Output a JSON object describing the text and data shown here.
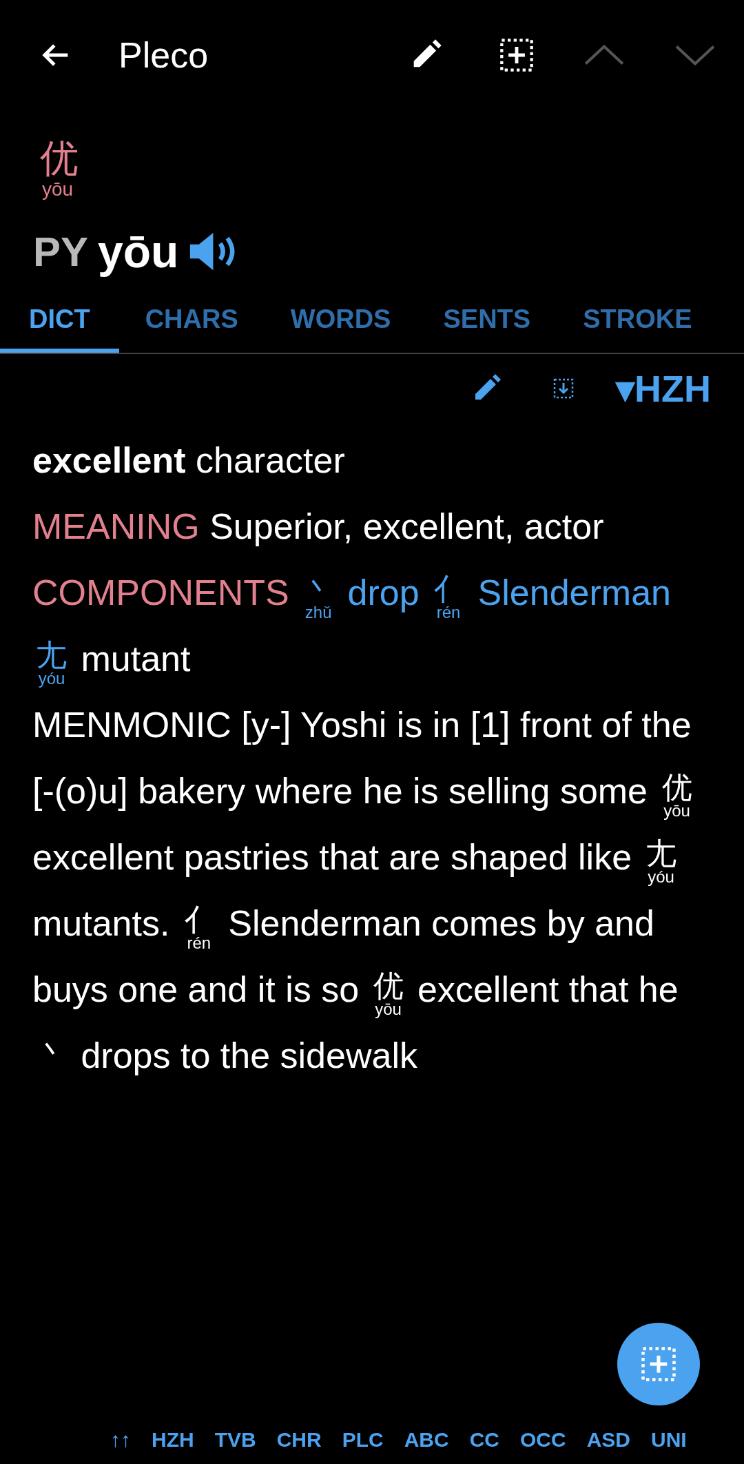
{
  "app_bar": {
    "title": "Pleco",
    "up_disabled": true,
    "down_disabled": true
  },
  "headword": {
    "character": "优",
    "pinyin": "yōu"
  },
  "reading": {
    "label": "PY",
    "pinyin": "yōu"
  },
  "tabs": [
    {
      "label": "DICT",
      "selected": true
    },
    {
      "label": "CHARS",
      "selected": false
    },
    {
      "label": "WORDS",
      "selected": false
    },
    {
      "label": "SENTS",
      "selected": false
    },
    {
      "label": "STROKE",
      "selected": false
    }
  ],
  "entry_toolbar": {
    "dictionary": "▾HZH"
  },
  "definition": [
    [
      {
        "kind": "bold",
        "text": "excellent"
      },
      {
        "kind": "text",
        "text": "character"
      }
    ],
    [
      {
        "kind": "label",
        "text": "MEANING"
      },
      {
        "kind": "text",
        "text": "Superior, excellent, actor"
      }
    ],
    [
      {
        "kind": "label",
        "text": "COMPONENTS"
      },
      {
        "kind": "ruby_link",
        "char": "丶",
        "pinyin": "zhǔ"
      },
      {
        "kind": "link",
        "text": "drop"
      },
      {
        "kind": "ruby_link",
        "char": "亻",
        "pinyin": "rén"
      },
      {
        "kind": "link",
        "text": "Slenderman"
      },
      {
        "kind": "ruby_link",
        "char": "尢",
        "pinyin": "yóu"
      },
      {
        "kind": "text",
        "text": "mutant"
      }
    ],
    [
      {
        "kind": "text",
        "text": "MENMONIC [y-] Yoshi is in [1] front of the [-(o)u] bakery where he is selling some"
      },
      {
        "kind": "ruby",
        "char": "优",
        "pinyin": "yōu"
      },
      {
        "kind": "text",
        "text": "excellent pastries that are shaped like"
      },
      {
        "kind": "ruby",
        "char": "尢",
        "pinyin": "yóu"
      },
      {
        "kind": "text",
        "text": "mutants."
      },
      {
        "kind": "ruby",
        "char": "亻",
        "pinyin": "rén"
      },
      {
        "kind": "text",
        "text": "Slenderman comes by and buys one and it is so"
      },
      {
        "kind": "ruby",
        "char": "优",
        "pinyin": "yōu"
      },
      {
        "kind": "text",
        "text": "excellent that he"
      },
      {
        "kind": "ruby",
        "char": "丶"
      },
      {
        "kind": "text",
        "text": "drops to the sidewalk"
      }
    ]
  ],
  "dictionary_bar": {
    "jump": "↑↑",
    "dictionaries": [
      "HZH",
      "TVB",
      "CHR",
      "PLC",
      "ABC",
      "CC",
      "OCC",
      "ASD",
      "UNI"
    ]
  }
}
